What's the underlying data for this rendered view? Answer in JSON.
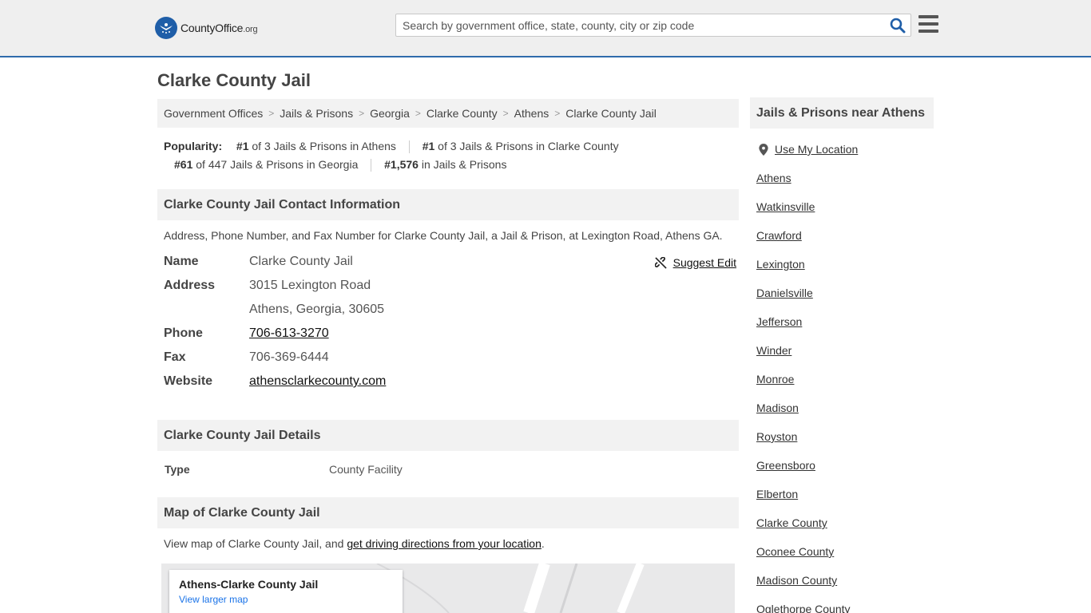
{
  "header": {
    "logo_text_main": "CountyOffice",
    "logo_text_suffix": ".org",
    "search_placeholder": "Search by government office, state, county, city or zip code"
  },
  "page_title": "Clarke County Jail",
  "breadcrumb": [
    "Government Offices",
    "Jails & Prisons",
    "Georgia",
    "Clarke County",
    "Athens",
    "Clarke County Jail"
  ],
  "popularity": {
    "label": "Popularity:",
    "items": [
      {
        "rank": "#1",
        "text": "of 3 Jails & Prisons in Athens"
      },
      {
        "rank": "#1",
        "text": "of 3 Jails & Prisons in Clarke County"
      },
      {
        "rank": "#61",
        "text": "of 447 Jails & Prisons in Georgia"
      },
      {
        "rank": "#1,576",
        "text": "in Jails & Prisons"
      }
    ]
  },
  "contact": {
    "heading": "Clarke County Jail Contact Information",
    "description": "Address, Phone Number, and Fax Number for Clarke County Jail, a Jail & Prison, at Lexington Road, Athens GA.",
    "suggest_edit": "Suggest Edit",
    "name_label": "Name",
    "name": "Clarke County Jail",
    "address_label": "Address",
    "address_line1": "3015 Lexington Road",
    "address_line2": "Athens, Georgia, 30605",
    "phone_label": "Phone",
    "phone": "706-613-3270",
    "fax_label": "Fax",
    "fax": "706-369-6444",
    "website_label": "Website",
    "website": "athensclarkecounty.com"
  },
  "details": {
    "heading": "Clarke County Jail Details",
    "type_label": "Type",
    "type_value": "County Facility"
  },
  "map_section": {
    "heading": "Map of Clarke County Jail",
    "desc_prefix": "View map of Clarke County Jail, and ",
    "desc_link": "get driving directions from your location",
    "desc_suffix": ".",
    "card_title": "Athens-Clarke County Jail",
    "card_link": "View larger map"
  },
  "sidebar": {
    "heading": "Jails & Prisons near Athens",
    "use_location": "Use My Location",
    "links": [
      "Athens",
      "Watkinsville",
      "Crawford",
      "Lexington",
      "Danielsville",
      "Jefferson",
      "Winder",
      "Monroe",
      "Madison",
      "Royston",
      "Greensboro",
      "Elberton",
      "Clarke County",
      "Oconee County",
      "Madison County",
      "Oglethorpe County"
    ]
  },
  "colors": {
    "brand_blue": "#1f5ea8",
    "header_border": "#2f6bab",
    "panel_gray": "#f2f2f2"
  }
}
